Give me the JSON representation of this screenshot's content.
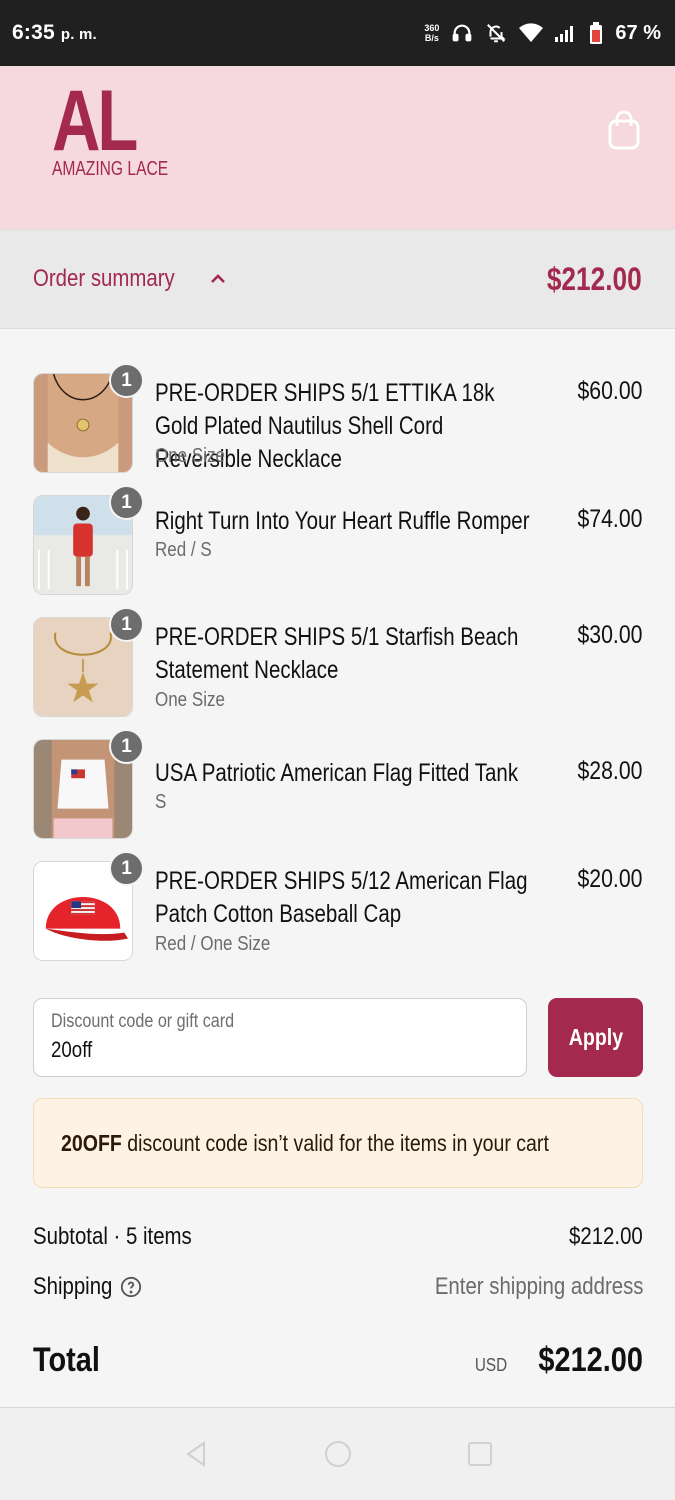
{
  "status_bar": {
    "time": "6:35",
    "ampm": "p. m.",
    "net_speed_top": "360",
    "net_speed_bottom": "B/s",
    "battery": "67 %",
    "icons": [
      "headphones-icon",
      "bell-off-icon",
      "wifi-icon",
      "signal-icon",
      "battery-icon"
    ]
  },
  "header": {
    "logo_mark": "AL",
    "logo_name": "AMAZING LACE",
    "cart_icon": "shopping-bag-icon"
  },
  "summary": {
    "label": "Order summary",
    "total": "$212.00"
  },
  "items": [
    {
      "name": "PRE-ORDER SHIPS 5/1 ETTIKA 18k Gold Plated Nautilus Shell Cord Reversible Necklace",
      "variant": "One Size",
      "price": "$60.00",
      "qty": "1"
    },
    {
      "name": "Right Turn Into Your Heart Ruffle Romper",
      "variant": "Red / S",
      "price": "$74.00",
      "qty": "1"
    },
    {
      "name": "PRE-ORDER SHIPS 5/1 Starfish Beach Statement Necklace",
      "variant": "One Size",
      "price": "$30.00",
      "qty": "1"
    },
    {
      "name": "USA Patriotic American Flag Fitted Tank",
      "variant": "S",
      "price": "$28.00",
      "qty": "1"
    },
    {
      "name": "PRE-ORDER SHIPS 5/12 American Flag Patch Cotton Baseball Cap",
      "variant": "Red / One Size",
      "price": "$20.00",
      "qty": "1"
    }
  ],
  "discount": {
    "label": "Discount code or gift card",
    "value": "20off",
    "apply_label": "Apply",
    "error_code": "20OFF",
    "error_message": " discount code isn’t valid for the items in your cart"
  },
  "totals": {
    "subtotal_label": "Subtotal · 5 items",
    "subtotal_value": "$212.00",
    "shipping_label": "Shipping",
    "shipping_value": "Enter shipping address",
    "total_label": "Total",
    "currency": "USD",
    "total_value": "$212.00"
  },
  "colors": {
    "brand": "#a3294f",
    "header_bg": "#f6d9de",
    "error_bg": "#fdf2e3"
  }
}
